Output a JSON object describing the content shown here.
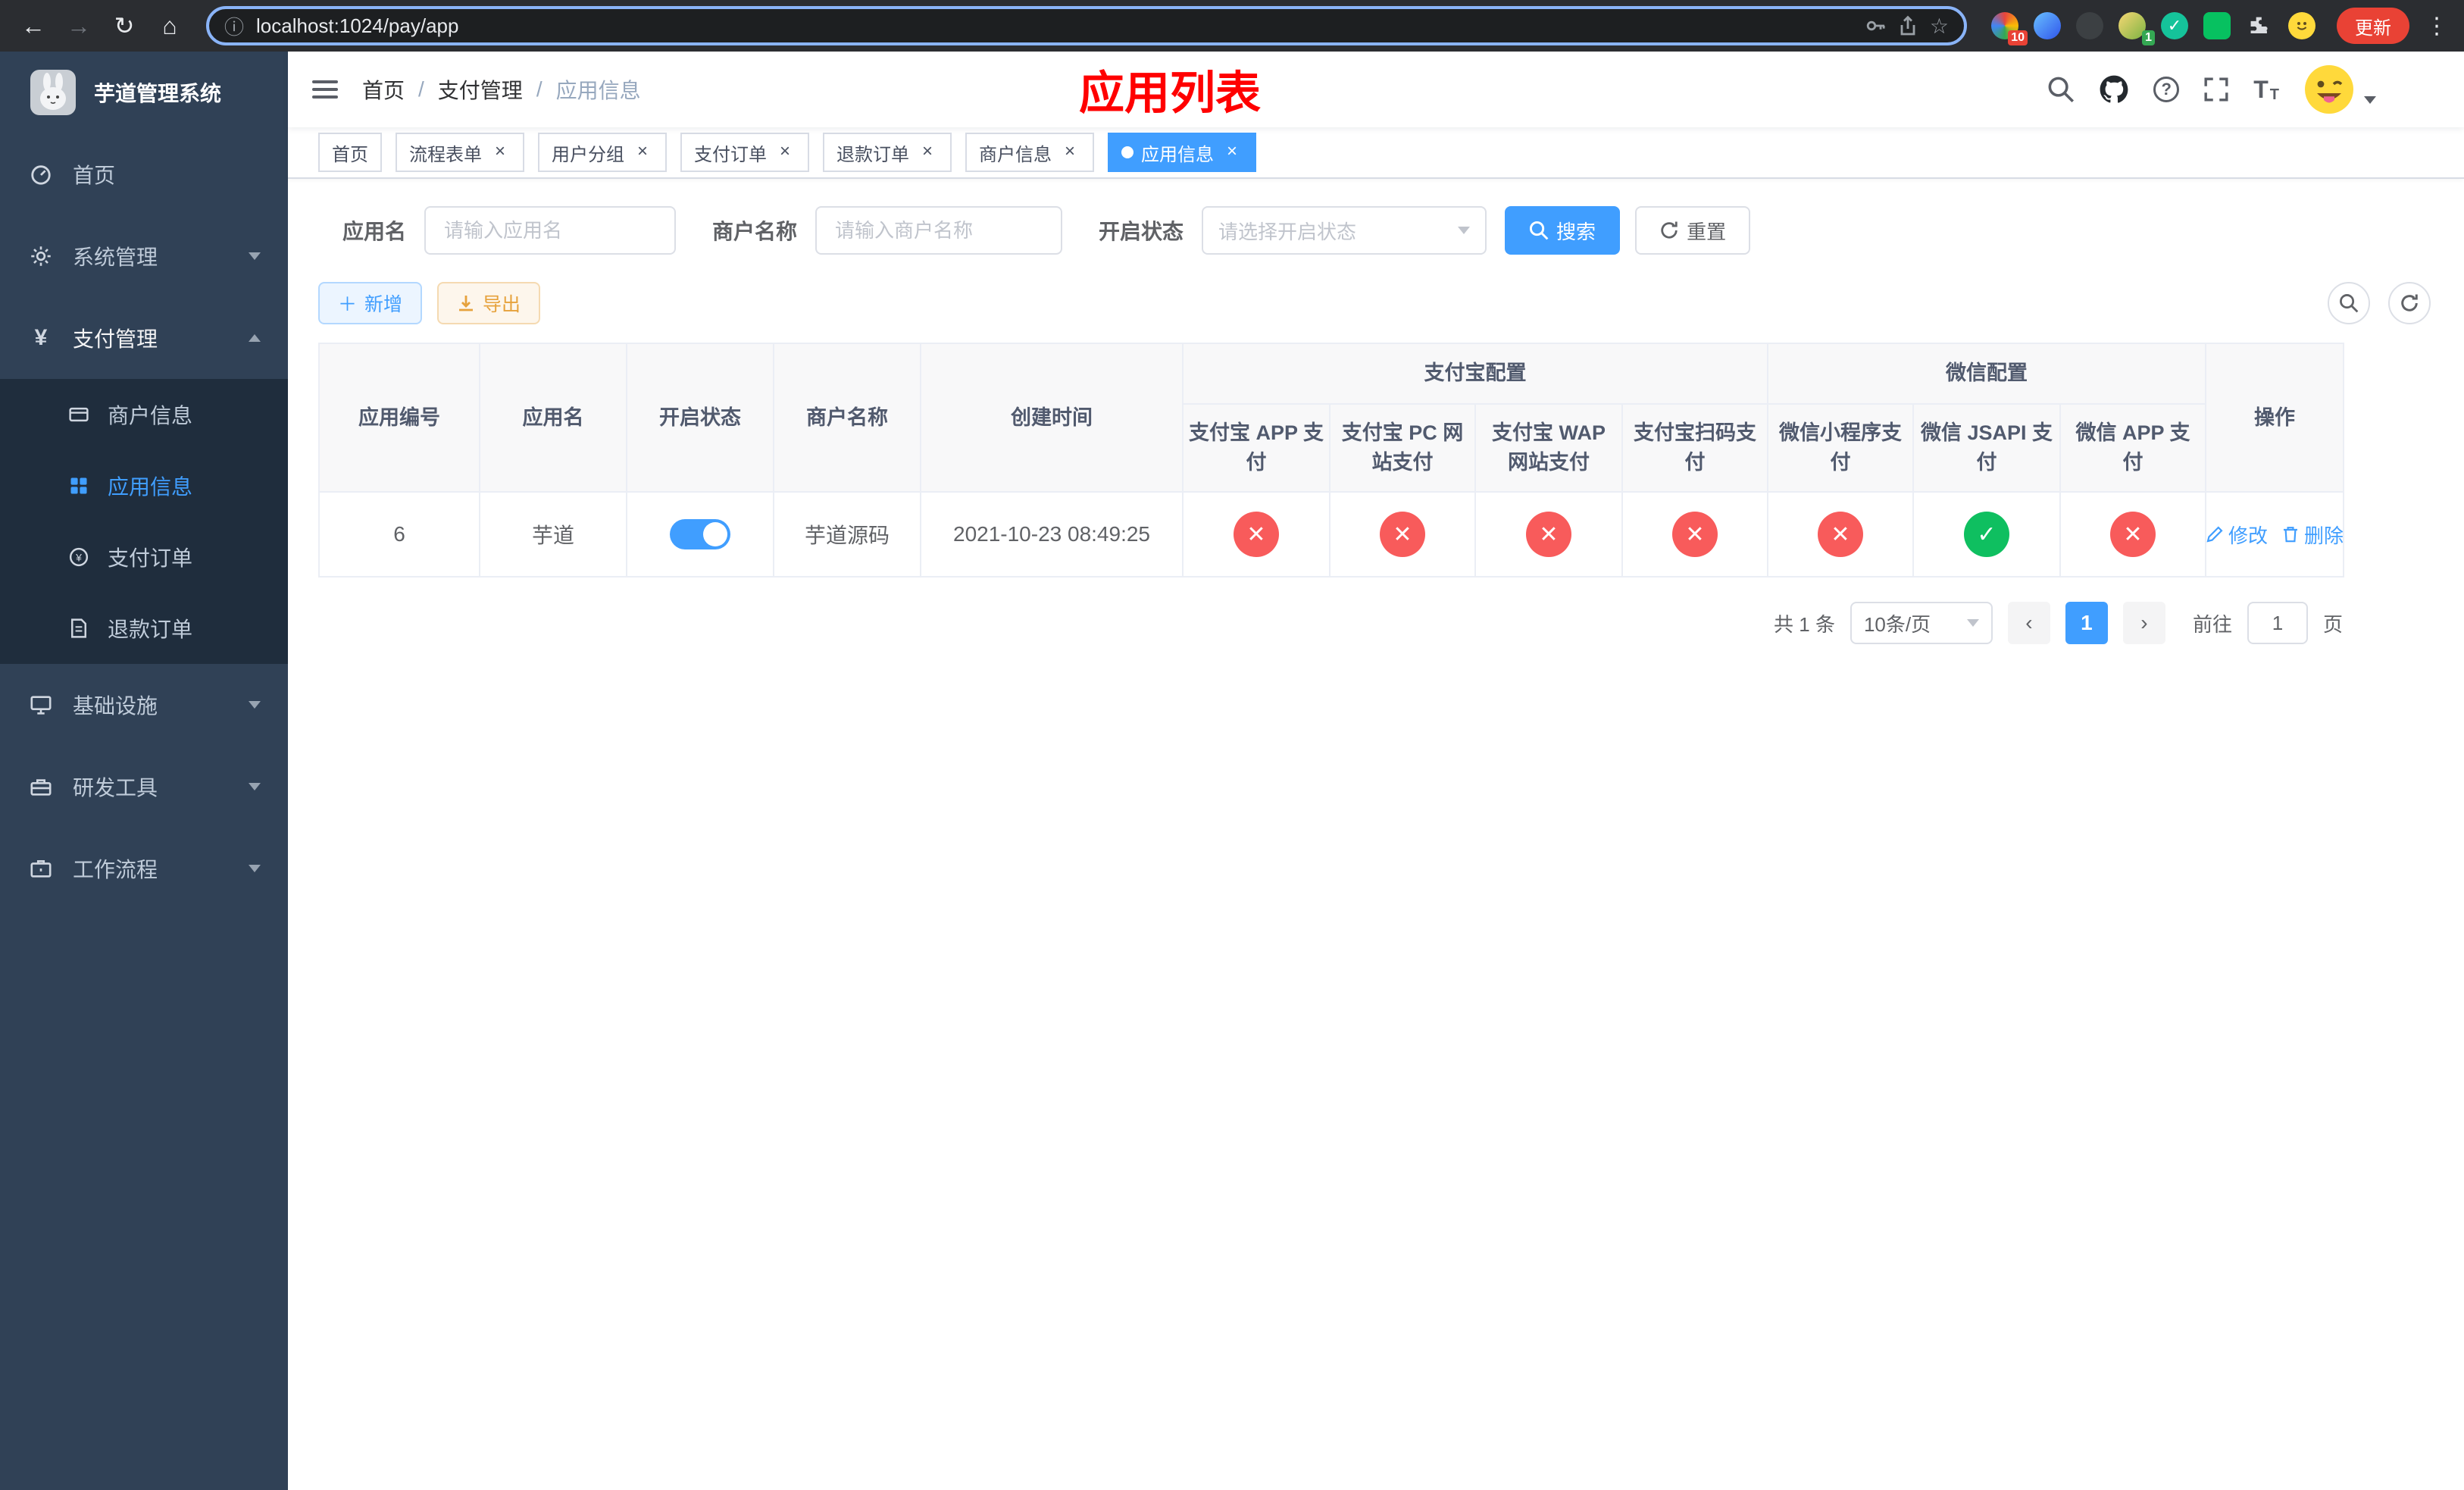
{
  "browser": {
    "url": "localhost:1024/pay/app",
    "update_label": "更新",
    "ext_badges": {
      "first": "10",
      "second": "1"
    }
  },
  "sidebar": {
    "title": "芋道管理系统",
    "items": [
      {
        "label": "首页"
      },
      {
        "label": "系统管理"
      },
      {
        "label": "支付管理"
      },
      {
        "label": "基础设施"
      },
      {
        "label": "研发工具"
      },
      {
        "label": "工作流程"
      }
    ],
    "payment_submenu": [
      {
        "label": "商户信息"
      },
      {
        "label": "应用信息"
      },
      {
        "label": "支付订单"
      },
      {
        "label": "退款订单"
      }
    ]
  },
  "header": {
    "breadcrumb": [
      "首页",
      "支付管理",
      "应用信息"
    ],
    "breadcrumb_sep": "/",
    "page_title": "应用列表"
  },
  "tabs": [
    {
      "label": "首页"
    },
    {
      "label": "流程表单"
    },
    {
      "label": "用户分组"
    },
    {
      "label": "支付订单"
    },
    {
      "label": "退款订单"
    },
    {
      "label": "商户信息"
    },
    {
      "label": "应用信息"
    }
  ],
  "filters": {
    "app_name_label": "应用名",
    "app_name_placeholder": "请输入应用名",
    "merchant_label": "商户名称",
    "merchant_placeholder": "请输入商户名称",
    "status_label": "开启状态",
    "status_placeholder": "请选择开启状态",
    "search_label": "搜索",
    "reset_label": "重置"
  },
  "toolbar": {
    "add_label": "新增",
    "export_label": "导出"
  },
  "table": {
    "groups": [
      "支付宝配置",
      "微信配置"
    ],
    "columns": [
      "应用编号",
      "应用名",
      "开启状态",
      "商户名称",
      "创建时间"
    ],
    "channel_columns": [
      "支付宝 APP 支付",
      "支付宝 PC 网站支付",
      "支付宝 WAP 网站支付",
      "支付宝扫码支付",
      "微信小程序支付",
      "微信 JSAPI 支付",
      "微信 APP 支付"
    ],
    "actions_column": "操作",
    "rows": [
      {
        "id": "6",
        "name": "芋道",
        "enabled": true,
        "merchant": "芋道源码",
        "created_at": "2021-10-23 08:49:25",
        "channels": [
          false,
          false,
          false,
          false,
          false,
          true,
          false
        ]
      }
    ],
    "edit_label": "修改",
    "delete_label": "删除"
  },
  "pagination": {
    "total": "共 1 条",
    "page_size": "10条/页",
    "current_page": "1",
    "goto_label": "前往",
    "goto_value": "1",
    "unit_label": "页"
  },
  "icons": {
    "check": "✓",
    "cross": "✕",
    "close": "×",
    "prev": "‹",
    "next": "›"
  },
  "colors": {
    "accent": "#409eff",
    "success": "#0fbf60",
    "danger": "#f85b5b",
    "warning": "#e6a23c",
    "annotation_red": "#ff0000",
    "sidebar_bg": "#304156",
    "submenu_bg": "#1f2d3d"
  }
}
